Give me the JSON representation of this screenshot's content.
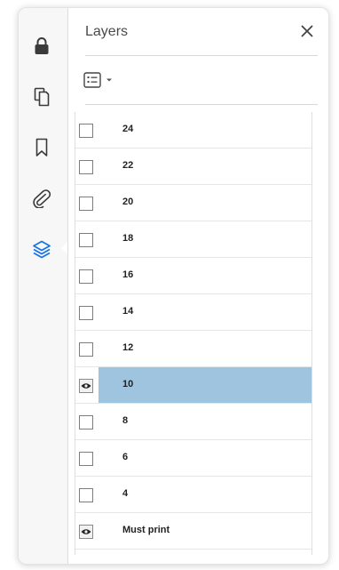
{
  "panel": {
    "title": "Layers",
    "options_icon": "list-options-icon",
    "close_icon": "close-icon"
  },
  "rail": {
    "items": [
      {
        "icon": "lock-icon",
        "active": false
      },
      {
        "icon": "pages-icon",
        "active": false
      },
      {
        "icon": "bookmark-icon",
        "active": false
      },
      {
        "icon": "attachment-icon",
        "active": false
      },
      {
        "icon": "layers-icon",
        "active": true
      }
    ]
  },
  "layers": [
    {
      "name": "24",
      "visible": false,
      "selected": false
    },
    {
      "name": "22",
      "visible": false,
      "selected": false
    },
    {
      "name": "20",
      "visible": false,
      "selected": false
    },
    {
      "name": "18",
      "visible": false,
      "selected": false
    },
    {
      "name": "16",
      "visible": false,
      "selected": false
    },
    {
      "name": "14",
      "visible": false,
      "selected": false
    },
    {
      "name": "12",
      "visible": false,
      "selected": false
    },
    {
      "name": "10",
      "visible": true,
      "selected": true
    },
    {
      "name": "8",
      "visible": false,
      "selected": false
    },
    {
      "name": "6",
      "visible": false,
      "selected": false
    },
    {
      "name": "4",
      "visible": false,
      "selected": false
    },
    {
      "name": "Must print",
      "visible": true,
      "selected": false
    }
  ],
  "colors": {
    "accent": "#1473e6",
    "selection": "#9ec4df",
    "icon": "#3a3a3a"
  }
}
